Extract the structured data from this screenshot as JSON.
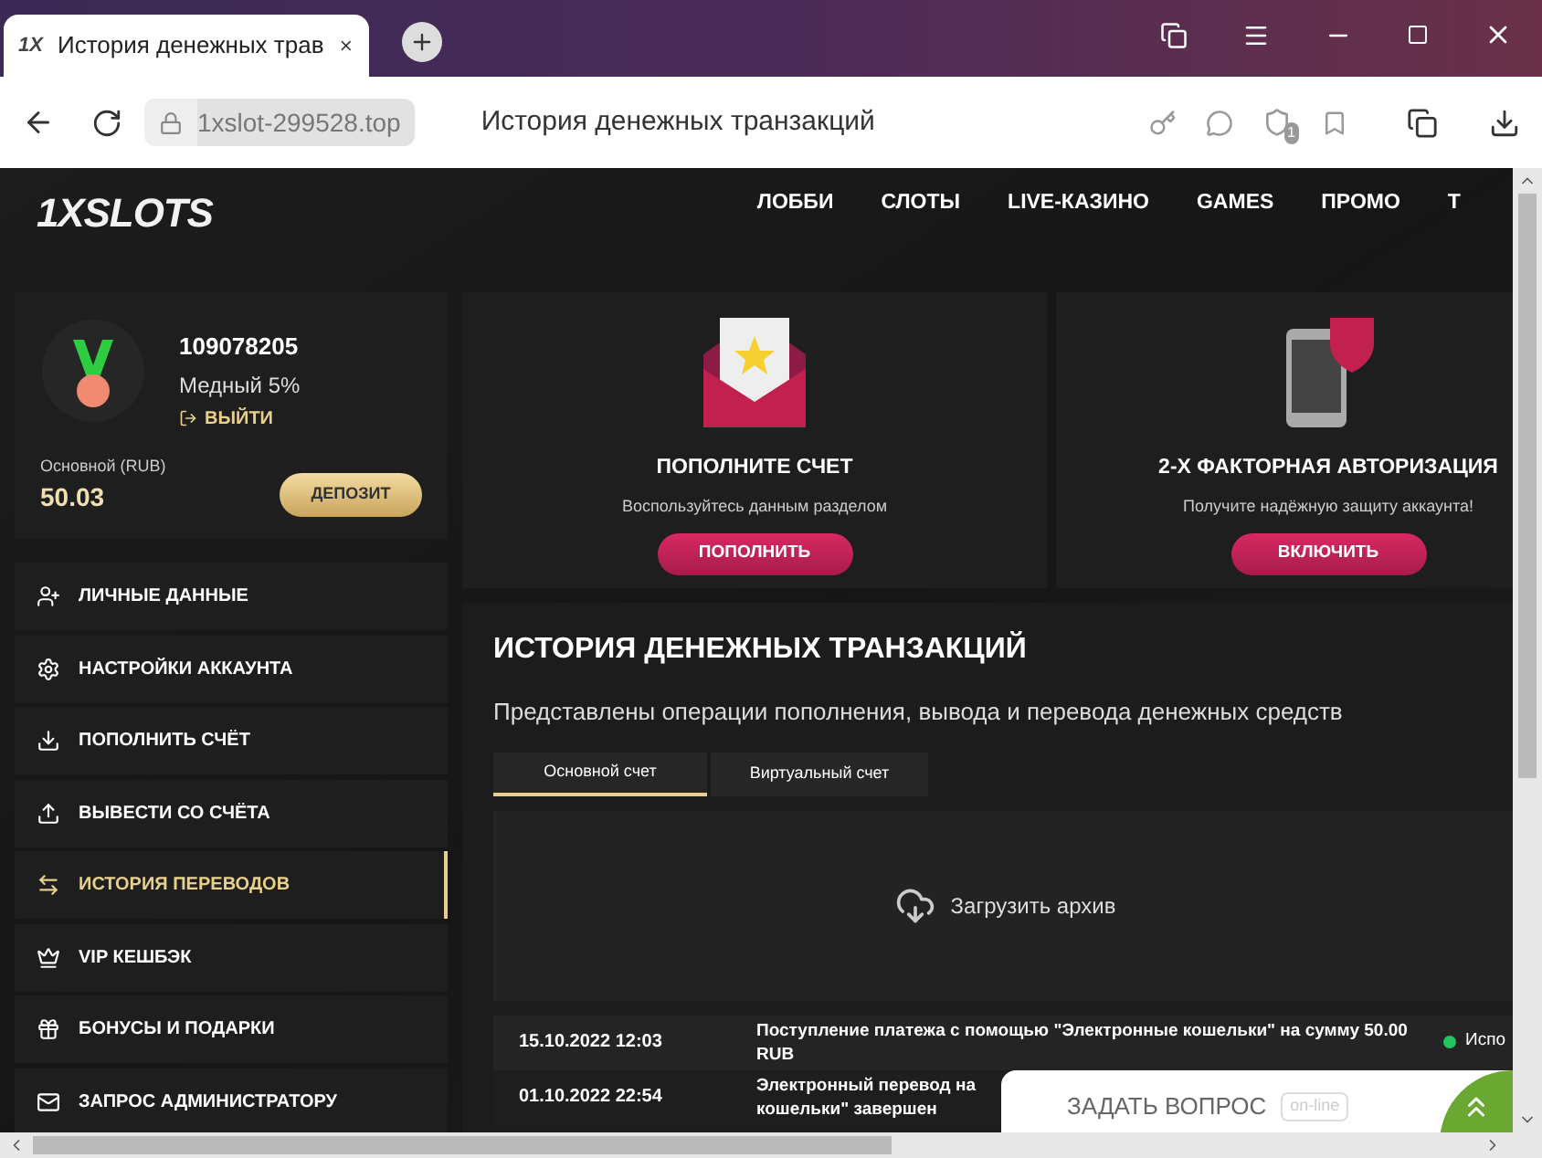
{
  "browser": {
    "favicon": "1X",
    "tab_title": "История денежных трав",
    "url": "1xslot-299528.top",
    "page_title": "История денежных транзакций",
    "badge": "1"
  },
  "header": {
    "logo": "1XSLOTS",
    "nav": [
      "ЛОББИ",
      "СЛОТЫ",
      "LIVE-КАЗИНО",
      "GAMES",
      "ПРОМО",
      "Т"
    ]
  },
  "profile": {
    "id": "109078205",
    "level": "Медный 5%",
    "logout": "ВЫЙТИ",
    "balance_label": "Основной (RUB)",
    "balance": "50.03",
    "deposit_button": "ДЕПОЗИТ"
  },
  "sidebar": {
    "items": [
      {
        "label": "ЛИЧНЫЕ ДАННЫЕ",
        "selected": false
      },
      {
        "label": "НАСТРОЙКИ АККАУНТА",
        "selected": false
      },
      {
        "label": "ПОПОЛНИТЬ СЧЁТ",
        "selected": false
      },
      {
        "label": "ВЫВЕСТИ СО СЧЁТА",
        "selected": false
      },
      {
        "label": "ИСТОРИЯ ПЕРЕВОДОВ",
        "selected": true
      },
      {
        "label": "VIP КЕШБЭК",
        "selected": false
      },
      {
        "label": "БОНУСЫ И ПОДАРКИ",
        "selected": false
      },
      {
        "label": "ЗАПРОС АДМИНИСТРАТОРУ",
        "selected": false
      }
    ]
  },
  "promo_cards": [
    {
      "title": "ПОПОЛНИТЕ СЧЕТ",
      "subtitle": "Воспользуйтесь данным разделом",
      "button": "ПОПОЛНИТЬ"
    },
    {
      "title": "2-Х ФАКТОРНАЯ АВТОРИЗАЦИЯ",
      "subtitle": "Получите надёжную защиту аккаунта!",
      "button": "ВКЛЮЧИТЬ"
    }
  ],
  "history": {
    "title": "ИСТОРИЯ ДЕНЕЖНЫХ ТРАНЗАКЦИЙ",
    "subtitle": "Представлены операции пополнения, вывода и перевода денежных средств",
    "tabs": [
      {
        "label": "Основной счет",
        "selected": true
      },
      {
        "label": "Виртуальный счет",
        "selected": false
      }
    ],
    "archive_button": "Загрузить архив",
    "rows": [
      {
        "date": "15.10.2022 12:03",
        "description": [
          "Поступление платежа с помощью \"Электронные кошельки\" на сумму 50.00",
          "RUB"
        ],
        "status": "Испо",
        "color": "#22c55e"
      },
      {
        "date": "01.10.2022 22:54",
        "description": [
          "Электронный перевод на",
          "кошельки\" завершен"
        ]
      }
    ]
  },
  "chat": {
    "label": "ЗАДАТЬ ВОПРОС",
    "badge": "on-line"
  }
}
